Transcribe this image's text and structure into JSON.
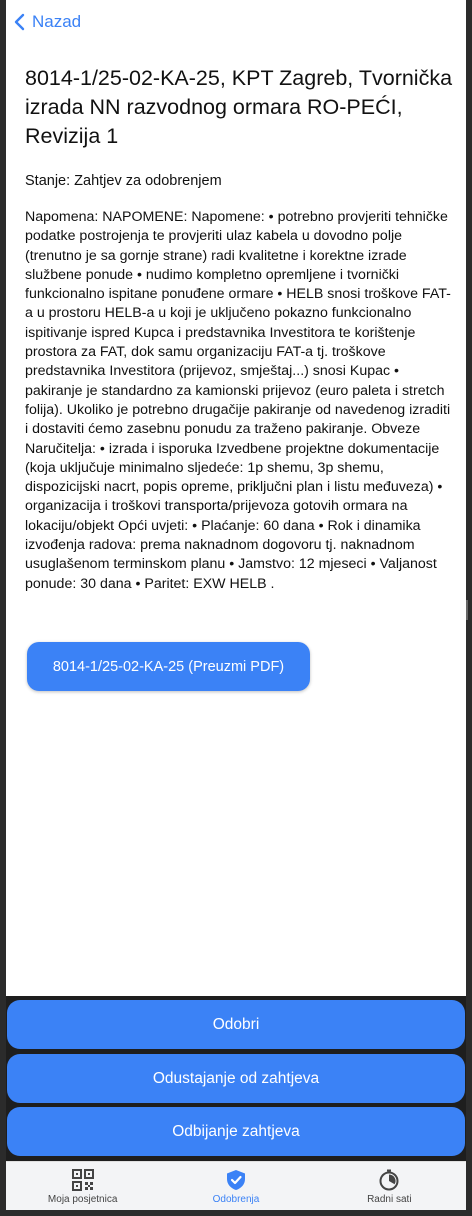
{
  "nav": {
    "back_label": "Nazad"
  },
  "offer": {
    "title": "8014-1/25-02-KA-25, KPT Zagreb, Tvornička izrada NN razvodnog ormara RO-PEĆI, Revizija 1",
    "status": "Stanje: Zahtjev za odobrenjem",
    "note": "Napomena: NAPOMENE: Napomene: • potrebno provjeriti tehničke podatke postrojenja te provjeriti ulaz kabela u dovodno polje (trenutno je sa gornje strane) radi kvalitetne i korektne izrade službene ponude • nudimo kompletno opremljene i tvornički funkcionalno ispitane ponuđene ormare • HELB snosi troškove FAT-a u prostoru HELB-a u koji je uključeno pokazno funkcionalno ispitivanje ispred Kupca i predstavnika Investitora te korištenje prostora za FAT, dok samu organizaciju FAT-a tj. troškove predstavnika Investitora (prijevoz, smještaj...) snosi Kupac • pakiranje je standardno za kamionski prijevoz (euro paleta i stretch folija). Ukoliko je potrebno drugačije pakiranje od navedenog izraditi i dostaviti ćemo zasebnu ponudu za traženo pakiranje. Obveze Naručitelja: • izrada i isporuka Izvedbene projektne dokumentacije (koja uključuje minimalno sljedeće: 1p shemu, 3p shemu, dispozicijski nacrt, popis opreme, priključni plan i listu međuveza) • organizacija i troškovi transporta/prijevoza gotovih ormara na lokaciju/objekt Opći uvjeti: • Plaćanje: 60 dana • Rok i dinamika izvođenja radova: prema naknadnom dogovoru tj. naknadnom usuglašenom terminskom planu • Jamstvo: 12 mjeseci • Valjanost ponude: 30 dana • Paritet: EXW HELB .",
    "pdf_button_label": "8014-1/25-02-KA-25 (Preuzmi PDF)"
  },
  "actions": {
    "approve_label": "Odobri",
    "withdraw_label": "Odustajanje od zahtjeva",
    "reject_label": "Odbijanje zahtjeva"
  },
  "tabs": [
    {
      "label": "Moja posjetnica",
      "icon": "qr-code-icon"
    },
    {
      "label": "Odobrenja",
      "icon": "shield-check-icon"
    },
    {
      "label": "Radni sati",
      "icon": "timer-icon"
    }
  ],
  "colors": {
    "accent": "#3b82f6",
    "action_bar_bg": "#1e1e1e",
    "tabbar_bg": "#f3f4f6"
  }
}
